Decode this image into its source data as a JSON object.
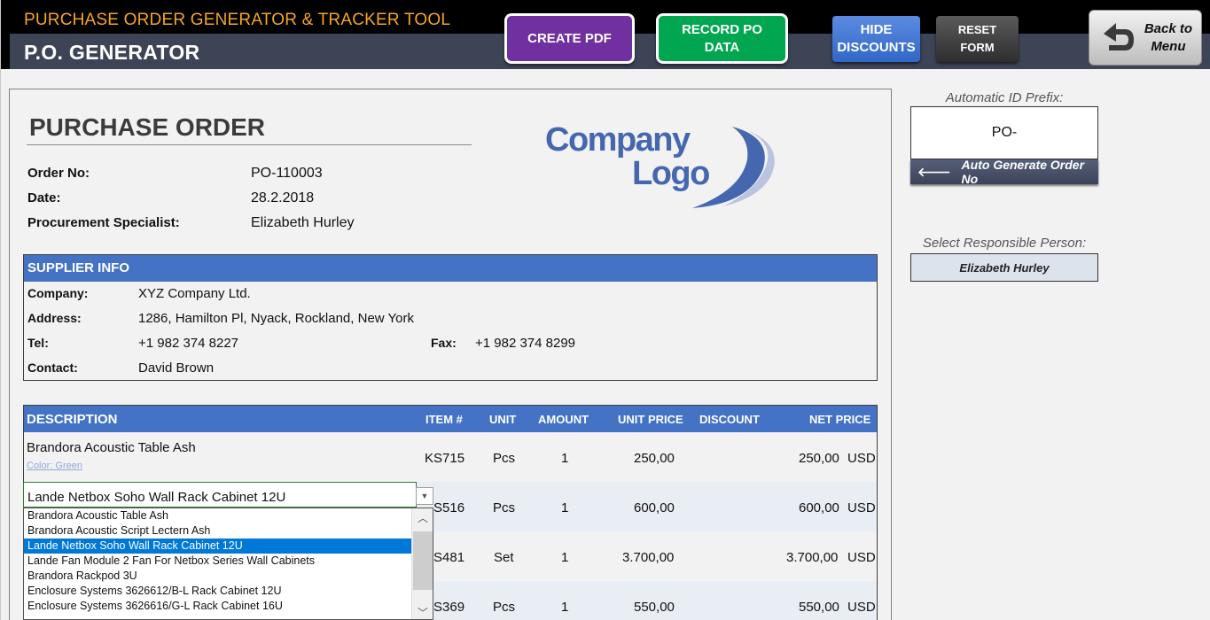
{
  "header": {
    "app_title": "PURCHASE ORDER GENERATOR & TRACKER TOOL",
    "section_title": "P.O. GENERATOR",
    "buttons": {
      "create_pdf": "CREATE PDF",
      "record_po_line1": "RECORD PO",
      "record_po_line2": "DATA",
      "hide_line1": "HIDE",
      "hide_line2": "DISCOUNTS",
      "reset_line1": "RESET",
      "reset_line2": "FORM",
      "back_line1": "Back to",
      "back_line2": "Menu"
    },
    "colors": {
      "create_pdf": "#7030a0",
      "record_po": "#00a650",
      "hide_discounts": "#3b72d4",
      "title_accent": "#f5a623"
    }
  },
  "po": {
    "title": "PURCHASE ORDER",
    "order_no_label": "Order No:",
    "order_no": "PO-110003",
    "date_label": "Date:",
    "date": "28.2.2018",
    "specialist_label": "Procurement Specialist:",
    "specialist": "Elizabeth Hurley",
    "logo_line1": "Company",
    "logo_line2": "Logo"
  },
  "supplier": {
    "heading": "SUPPLIER INFO",
    "company_label": "Company:",
    "company": "XYZ Company Ltd.",
    "address_label": "Address:",
    "address": "1286, Hamilton Pl, Nyack, Rockland, New York",
    "tel_label": "Tel:",
    "tel": "+1 982 374 8227",
    "fax_label": "Fax:",
    "fax": "+1 982 374 8299",
    "contact_label": "Contact:",
    "contact": "David Brown"
  },
  "items": {
    "columns": {
      "description": "DESCRIPTION",
      "item": "ITEM #",
      "unit": "UNIT",
      "amount": "AMOUNT",
      "unit_price": "UNIT PRICE",
      "discount": "DISCOUNT",
      "net_price": "NET PRICE"
    },
    "rows": [
      {
        "description": "Brandora Acoustic Table Ash",
        "note": "Color: Green",
        "item": "KS715",
        "unit": "Pcs",
        "amount": "1",
        "unit_price": "250,00",
        "net_price": "250,00",
        "currency": "USD"
      },
      {
        "description": "Lande Netbox Soho Wall Rack Cabinet 12U",
        "item": "KS516",
        "unit": "Pcs",
        "amount": "1",
        "unit_price": "600,00",
        "net_price": "600,00",
        "currency": "USD"
      },
      {
        "description": "",
        "item": "KS481",
        "unit": "Set",
        "amount": "1",
        "unit_price": "3.700,00",
        "net_price": "3.700,00",
        "currency": "USD"
      },
      {
        "description": "",
        "item": "KS369",
        "unit": "Pcs",
        "amount": "1",
        "unit_price": "550,00",
        "net_price": "550,00",
        "currency": "USD"
      }
    ],
    "item_visible_fragments": [
      "S516",
      "S481",
      "S369"
    ]
  },
  "dropdown": {
    "value": "Lande Netbox Soho Wall Rack Cabinet 12U",
    "options": [
      "Brandora Acoustic Table Ash",
      "Brandora Acoustic Script Lectern Ash",
      "Lande Netbox Soho Wall Rack Cabinet 12U",
      "Lande Fan Module 2 Fan For Netbox Series Wall Cabinets",
      "Brandora Rackpod 3U",
      "Enclosure Systems 3626612/B-L Rack Cabinet 12U",
      "Enclosure Systems 3626616/G-L Rack Cabinet 16U"
    ],
    "selected_index": 2
  },
  "right_panel": {
    "prefix_label": "Automatic ID Prefix:",
    "prefix_value": "PO-",
    "auto_generate": "Auto Generate Order No",
    "person_label": "Select Responsible Person:",
    "person_value": "Elizabeth Hurley"
  }
}
